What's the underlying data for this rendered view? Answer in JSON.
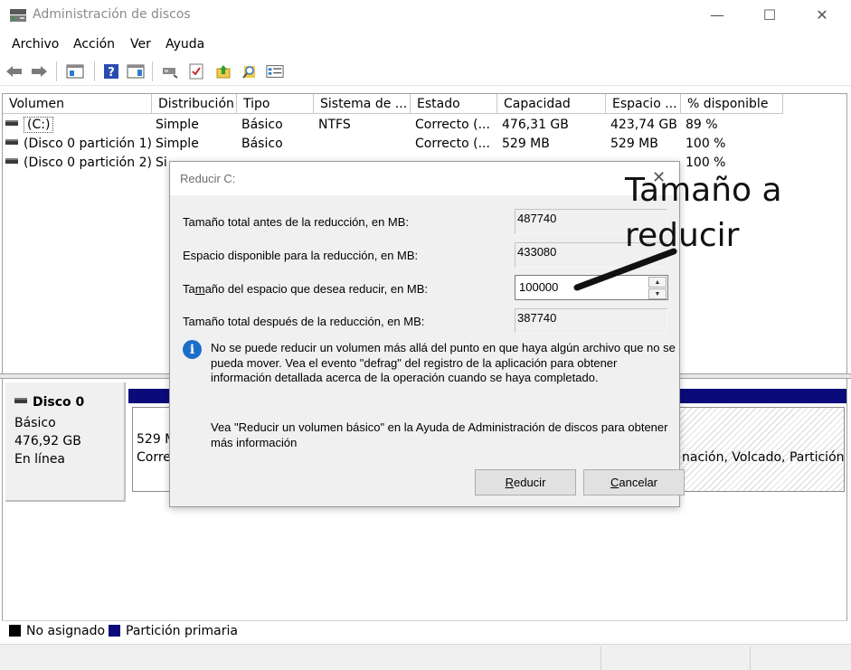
{
  "window": {
    "title": "Administración de discos",
    "controls": {
      "minimize": "—",
      "maximize": "☐",
      "close": "✕"
    }
  },
  "menu": [
    "Archivo",
    "Acción",
    "Ver",
    "Ayuda"
  ],
  "toolbar": {
    "icons": [
      "back-arrow-icon",
      "forward-arrow-icon",
      "console-tree-icon",
      "help-icon",
      "action-pane-icon",
      "connect-icon",
      "check-icon",
      "up-folder-icon",
      "search-icon",
      "properties-icon"
    ]
  },
  "volume_table": {
    "columns": [
      "Volumen",
      "Distribución",
      "Tipo",
      "Sistema de ...",
      "Estado",
      "Capacidad",
      "Espacio ...",
      "% disponible"
    ],
    "rows": [
      {
        "volumen": "(C:)",
        "distribucion": "Simple",
        "tipo": "Básico",
        "sistema": "NTFS",
        "estado": "Correcto (...",
        "capacidad": "476,31 GB",
        "espacio": "423,74 GB",
        "disponible": "89 %"
      },
      {
        "volumen": "(Disco 0 partición 1)",
        "distribucion": "Simple",
        "tipo": "Básico",
        "sistema": "",
        "estado": "Correcto (...",
        "capacidad": "529 MB",
        "espacio": "529 MB",
        "disponible": "100 %"
      },
      {
        "volumen": "(Disco 0 partición 2)",
        "distribucion": "Si",
        "tipo": "",
        "sistema": "",
        "estado": "",
        "capacidad": "",
        "espacio": "",
        "disponible": "100 %"
      }
    ]
  },
  "disk_map": {
    "disk_name": "Disco 0",
    "disk_type": "Básico",
    "disk_size": "476,92 GB",
    "disk_status": "En línea",
    "partition1_size": "529 M",
    "partition1_status": "Corre",
    "partition3_status": "nación, Volcado, Partición"
  },
  "legend": [
    {
      "label": "No asignado",
      "color": "#000000"
    },
    {
      "label": "Partición primaria",
      "color": "#0a0a7a"
    }
  ],
  "dialog": {
    "title": "Reducir C:",
    "close": "✕",
    "label_total_before": "Tamaño total antes de la reducción, en MB:",
    "value_total_before": "487740",
    "label_available": "Espacio disponible para la reducción, en MB:",
    "value_available": "433080",
    "label_shrink_prefix": "Ta",
    "label_shrink_accel": "m",
    "label_shrink_suffix": "año del espacio que desea reducir, en MB:",
    "value_shrink": "100000",
    "label_total_after": "Tamaño total después de la reducción, en MB:",
    "value_total_after": "387740",
    "info_text": "No se puede reducir un volumen más allá del punto en que haya algún archivo que no se pueda mover. Vea el evento \"defrag\" del registro de la aplicación para obtener información detallada acerca de la operación cuando se haya completado.",
    "help_text": "Vea \"Reducir un volumen básico\" en la Ayuda de Administración de discos para obtener más información",
    "btn_shrink_accel": "R",
    "btn_shrink_rest": "educir",
    "btn_cancel_accel": "C",
    "btn_cancel_rest": "ancelar"
  },
  "annotation": {
    "line1": "Tamaño a",
    "line2": "reducir",
    "color": "#000000"
  }
}
